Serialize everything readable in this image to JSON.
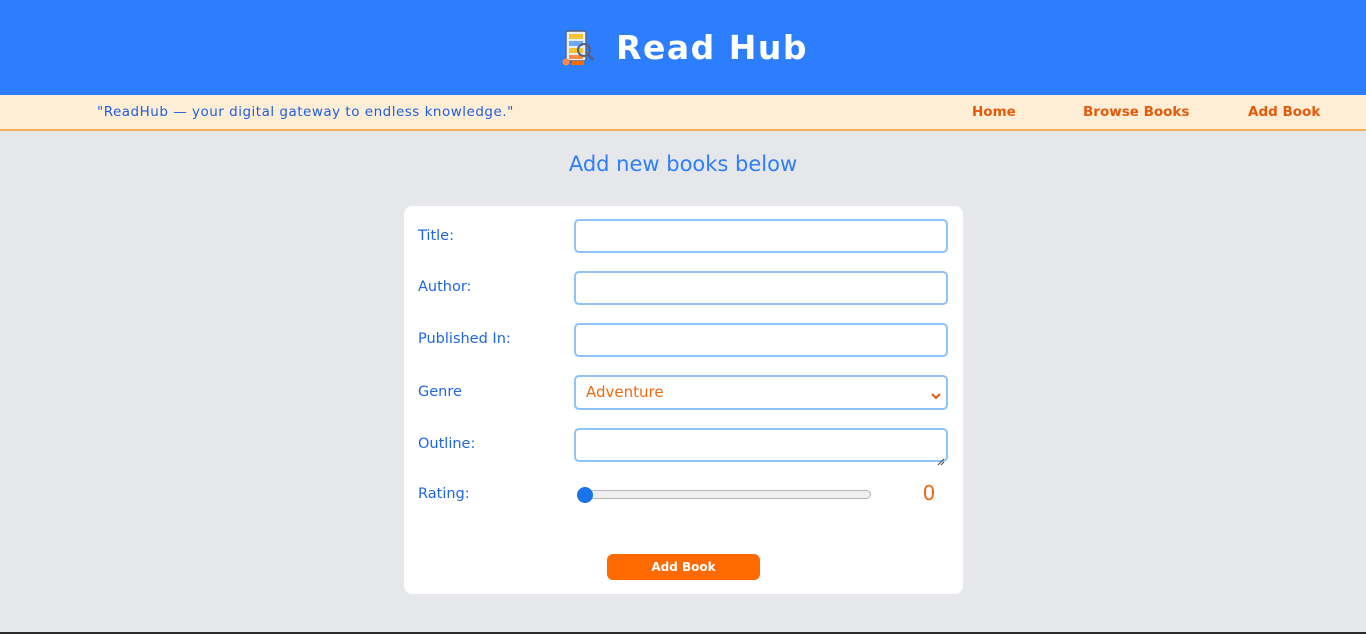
{
  "header": {
    "title": "Read Hub",
    "logo_icon": "book-shelf-icon",
    "background": "#2d7efe"
  },
  "navbar": {
    "tagline": "\"ReadHub — your digital gateway to endless knowledge.\"",
    "links": [
      {
        "label": "Home"
      },
      {
        "label": "Browse Books"
      },
      {
        "label": "Add Book"
      }
    ],
    "background": "#feeed5",
    "link_color": "#e45a0a"
  },
  "page": {
    "heading": "Add new books below"
  },
  "form": {
    "title_label": "Title:",
    "title_value": "",
    "author_label": "Author:",
    "author_value": "",
    "published_label": "Published In:",
    "published_value": "",
    "genre_label": "Genre",
    "genre_selected": "Adventure",
    "outline_label": "Outline:",
    "outline_value": "",
    "rating_label": "Rating:",
    "rating_value": "0",
    "submit_label": "Add Book"
  },
  "colors": {
    "accent": "#2d7efe",
    "button": "#ff6a00",
    "input_border": "#8cc3f8"
  }
}
